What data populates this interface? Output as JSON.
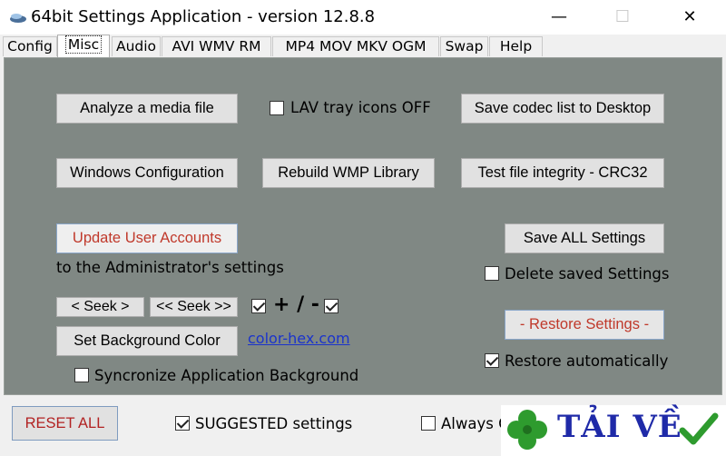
{
  "window": {
    "title": "64bit Settings Application - version 12.8.8",
    "minimize_glyph": "—",
    "maximize_glyph": "☐",
    "close_glyph": "✕"
  },
  "tabs": [
    {
      "label": "Config"
    },
    {
      "label": "Misc",
      "active": true
    },
    {
      "label": "Audio"
    },
    {
      "label": "AVI WMV RM"
    },
    {
      "label": "MP4 MOV MKV OGM"
    },
    {
      "label": "Swap"
    },
    {
      "label": "Help"
    }
  ],
  "misc": {
    "analyze_button": "Analyze a media file",
    "lav_tray_label": "LAV tray icons OFF",
    "lav_tray_checked": false,
    "save_codec_button": "Save codec list to Desktop",
    "windows_config_button": "Windows Configuration",
    "rebuild_wmp_button": "Rebuild WMP Library",
    "test_integrity_button": "Test file integrity - CRC32",
    "update_accounts_button": "Update User Accounts",
    "update_accounts_note": "to the Administrator's settings",
    "save_all_button": "Save ALL Settings",
    "delete_saved_label": "Delete saved Settings",
    "delete_saved_checked": false,
    "seek_button": "<  Seek  >",
    "seek_fast_button": "<< Seek >>",
    "plus_minus_text": "+ / -",
    "plus_checked": true,
    "minus_checked": true,
    "set_bg_button": "Set Background Color",
    "color_hex_link": "color-hex.com",
    "restore_button": "- Restore Settings -",
    "restore_auto_label": "Restore automatically",
    "restore_auto_checked": true,
    "sync_bg_label": "Syncronize Application Background",
    "sync_bg_checked": false
  },
  "bottom": {
    "reset_button": "RESET ALL",
    "suggested_label": "SUGGESTED settings",
    "suggested_checked": true,
    "always_label": "Always C"
  },
  "watermark": {
    "text": "TẢI VỀ",
    "icons": [
      "clover-icon",
      "checkmark-icon"
    ]
  },
  "colors": {
    "panel_bg": "#808884",
    "accent_red": "#c0392b",
    "link_blue": "#1a33cc",
    "watermark_blue": "#1f2aa8",
    "watermark_green": "#2e9b2e"
  }
}
